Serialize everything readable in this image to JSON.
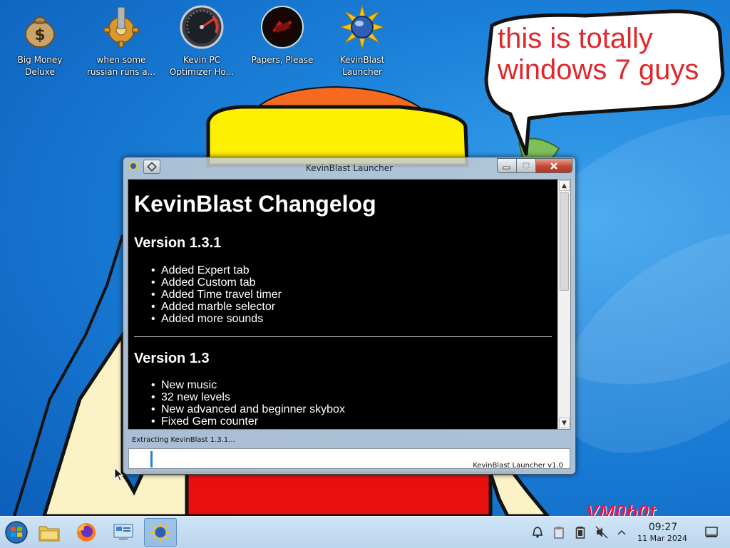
{
  "desktop": {
    "icons": [
      {
        "label_line1": "Big Money",
        "label_line2": "Deluxe",
        "icon": "money-bag-icon"
      },
      {
        "label_line1": "when some",
        "label_line2": "russian runs a...",
        "icon": "gear-icon"
      },
      {
        "label_line1": "Kevin PC",
        "label_line2": "Optimizer Ho...",
        "icon": "gauge-icon"
      },
      {
        "label_line1": "Papers, Please",
        "label_line2": "",
        "icon": "seal-icon"
      },
      {
        "label_line1": "KevinBlast",
        "label_line2": "Launcher",
        "icon": "kevinblast-icon"
      }
    ],
    "speech_bubble": {
      "line1": "this is totally",
      "line2": "windows 7 guys"
    },
    "watermark": "VM0b0t"
  },
  "window": {
    "title": "KevinBlast Launcher",
    "changelog": {
      "title": "KevinBlast Changelog",
      "versions": [
        {
          "heading": "Version 1.3.1",
          "changes": [
            "Added Expert tab",
            "Added Custom tab",
            "Added Time travel timer",
            "Added marble selector",
            "Added more sounds"
          ]
        },
        {
          "heading": "Version 1.3",
          "changes": [
            "New music",
            "32 new levels",
            "New advanced and beginner skybox",
            "Fixed Gem counter"
          ]
        }
      ]
    },
    "status_text": "Extracting KevinBlast 1.3.1...",
    "progress_fraction": 0.05,
    "version_label": "KevinBlast Launcher v1.0"
  },
  "taskbar": {
    "pinned": [
      "start-orb-icon",
      "file-manager-icon",
      "firefox-icon",
      "control-panel-icon",
      "kevinblast-icon"
    ],
    "tray": [
      "notification-bell-icon",
      "clipboard-icon",
      "battery-icon",
      "muted-speaker-icon",
      "chevron-up-icon"
    ],
    "clock": {
      "time": "09:27",
      "date": "11 Mar 2024"
    }
  },
  "colors": {
    "desktop_blue": "#1a7fd8",
    "bubble_text": "#e0282c",
    "progress_fill": "#2d7fd3",
    "watermark": "#e3174a"
  }
}
